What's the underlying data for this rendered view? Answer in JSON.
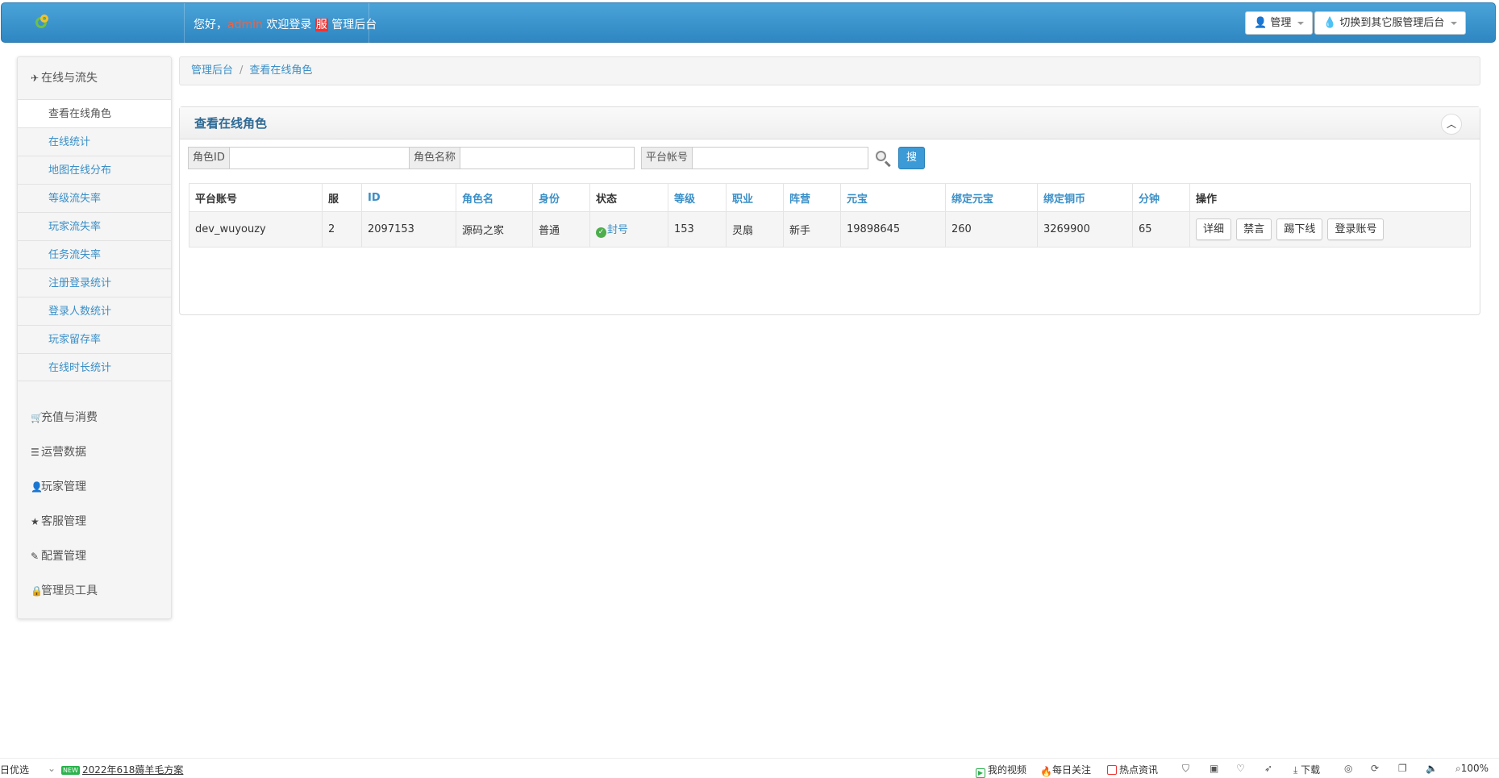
{
  "topbar": {
    "greeting": "您好，",
    "username": "admin",
    "welcome_text": " 欢迎登录 ",
    "server_mark": "服",
    "console_name": " 管理后台",
    "admin_menu_label": "管理",
    "switch_server_label": "切换到其它服管理后台"
  },
  "sidebar": {
    "section_title": "在线与流失",
    "items": [
      {
        "label": "查看在线角色",
        "active": true
      },
      {
        "label": "在线统计"
      },
      {
        "label": "地图在线分布"
      },
      {
        "label": "等级流失率"
      },
      {
        "label": "玩家流失率"
      },
      {
        "label": "任务流失率"
      },
      {
        "label": "注册登录统计"
      },
      {
        "label": "登录人数统计"
      },
      {
        "label": "玩家留存率"
      },
      {
        "label": "在线时长统计"
      }
    ],
    "groups": [
      {
        "label": "充值与消费",
        "icon": "cart-icon"
      },
      {
        "label": "运营数据",
        "icon": "list-icon"
      },
      {
        "label": "玩家管理",
        "icon": "user-icon"
      },
      {
        "label": "客服管理",
        "icon": "star-icon"
      },
      {
        "label": "配置管理",
        "icon": "edit-icon"
      },
      {
        "label": "管理员工具",
        "icon": "lock-icon"
      }
    ]
  },
  "breadcrumb": {
    "home": "管理后台",
    "separator": "/",
    "current": "查看在线角色"
  },
  "panel": {
    "title": "查看在线角色"
  },
  "search": {
    "role_id_label": "角色ID",
    "role_id_value": "",
    "role_name_label": "角色名称",
    "role_name_value": "",
    "platform_account_label": "平台帐号",
    "platform_account_value": "",
    "search_button": "搜索"
  },
  "table": {
    "headers": [
      "平台账号",
      "服",
      "ID",
      "角色名",
      "身份",
      "状态",
      "等级",
      "职业",
      "阵营",
      "元宝",
      "绑定元宝",
      "绑定铜币",
      "分钟",
      "操作"
    ],
    "rows": [
      {
        "platform_account": "dev_wuyouzy",
        "server": "2",
        "id": "2097153",
        "role_name": "源码之家",
        "identity": "普通",
        "status": "封号",
        "level": "153",
        "profession": "灵扇",
        "camp": "新手",
        "yuanbao": "19898645",
        "bound_yuanbao": "260",
        "bound_copper": "3269900",
        "minutes": "65",
        "actions": [
          "详细",
          "禁言",
          "踢下线",
          "登录账号"
        ]
      }
    ]
  },
  "statusbar": {
    "left_text": "日优选",
    "new_tag": "NEW",
    "promo": "2022年618薅羊毛方案",
    "my_video": "我的视频",
    "daily_follow": "每日关注",
    "hot_news": "热点资讯",
    "download": "下载",
    "zoom": "100%"
  }
}
